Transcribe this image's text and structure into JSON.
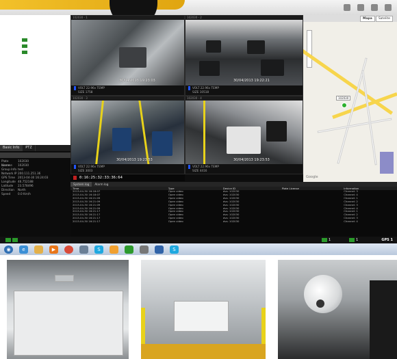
{
  "timestamp_bar": "0:16:25:32:33:36:64",
  "gps_label": "GPS",
  "map": {
    "tabs": [
      "Mapa",
      "Satelite"
    ],
    "marker_label": "102030",
    "google": "Google"
  },
  "left_panel": {
    "tabs": [
      "Basic Info",
      "PTZ"
    ],
    "rows": [
      [
        "Plate License",
        "102030"
      ],
      [
        "Name",
        "102030"
      ],
      [
        "Group Info",
        "test"
      ],
      [
        "Network IP",
        "200.111.251.36"
      ],
      [
        "GPS Time",
        "2013-04-30 16:24:03"
      ],
      [
        "Longitude",
        "46.752188"
      ],
      [
        "Latitude",
        "23.578496"
      ],
      [
        "Direction",
        "North"
      ],
      [
        "Speed",
        "0.0 Km/h"
      ]
    ]
  },
  "cameras": [
    {
      "title": "102030 - 1",
      "ts": "30/04/2013 19:23:03",
      "volt": "VOLT 22.96v",
      "temp": "TEMP",
      "size": "SIZE 1758"
    },
    {
      "title": "102030 - 2",
      "ts": "30/04/2013 19:22:21",
      "volt": "VOLT 22.96v",
      "temp": "TEMP",
      "size": "SIZE 10518"
    },
    {
      "title": "102030 - 3",
      "ts": "30/04/2013 19:23:53",
      "volt": "VOLT 22.96v",
      "temp": "TEMP",
      "size": "SIZE 3003"
    },
    {
      "title": "102030 - 4",
      "ts": "30/04/2013 19:23:53",
      "volt": "VOLT 22.96v",
      "temp": "TEMP",
      "size": "SIZE 4416"
    }
  ],
  "events": {
    "tabs": [
      "System log",
      "Alarm log"
    ],
    "headers": [
      "Time",
      "Type",
      "Device ID",
      "Plate License",
      "Information"
    ],
    "rows": [
      [
        "2013-04-30 16:18:07",
        "Open video",
        "dvs: 102030",
        "",
        "Channel: 3"
      ],
      [
        "2013-04-30 16:18:07",
        "Open video",
        "dvs: 102030",
        "",
        "Channel: 4"
      ],
      [
        "2013-04-30 16:21:09",
        "Open video",
        "dvs: 102030",
        "",
        "Channel: 1"
      ],
      [
        "2013-04-30 16:21:09",
        "Open video",
        "dvs: 102030",
        "",
        "Channel: 2"
      ],
      [
        "2013-04-30 16:21:09",
        "Open video",
        "dvs: 102030",
        "",
        "Channel: 3"
      ],
      [
        "2013-04-30 16:21:09",
        "Open video",
        "dvs: 102030",
        "",
        "Channel: 4"
      ],
      [
        "2013-04-30 16:21:17",
        "Open video",
        "dvs: 102030",
        "",
        "Channel: 1"
      ],
      [
        "2013-04-30 16:21:17",
        "Open video",
        "dvs: 102030",
        "",
        "Channel: 2"
      ],
      [
        "2013-04-30 16:21:17",
        "Open video",
        "dvs: 102030",
        "",
        "Channel: 3"
      ],
      [
        "2013-04-30 16:21:17",
        "Open video",
        "dvs: 102030",
        "",
        "Channel: 4"
      ]
    ]
  },
  "status_counts": [
    "1",
    "1",
    "1"
  ],
  "colors": {
    "accent_green": "#2a9a2a",
    "map_road": "#f7d54c",
    "volt_bar": "#2255ff"
  }
}
